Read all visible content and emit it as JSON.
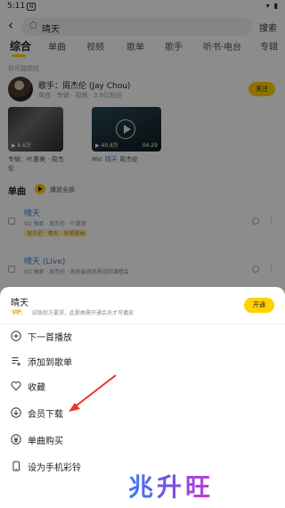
{
  "status": {
    "time": "5:11",
    "badge": "N"
  },
  "search": {
    "query": "晴天",
    "button": "搜索"
  },
  "tabs": [
    "综合",
    "单曲",
    "视频",
    "歌单",
    "歌手",
    "听书·电台",
    "专辑"
  ],
  "section_hint": "你可能想找",
  "artist": {
    "name": "歌手：周杰伦 (Jay Chou)",
    "sub": "单曲 · 专辑 · 视频 · 3.6亿粉丝",
    "follow": "关注"
  },
  "cards": [
    {
      "count": "▶ 6.6万",
      "caption": "专辑：叶惠美 · 周杰伦"
    },
    {
      "count": "▶ 40.8万",
      "duration": "04:29",
      "caption_prefix": "MV: ",
      "caption_hl": "晴天",
      "caption_suffix": " 周杰伦"
    }
  ],
  "singles": {
    "title": "单曲",
    "play_all": "播放全部"
  },
  "songs": [
    {
      "title": "晴天",
      "meta": "SQ 独家 · 周杰伦 · 叶惠美",
      "tag": "周杰伦 · 晴天 · 原唱歌曲"
    },
    {
      "title": "晴天 (Live)",
      "meta": "SQ 独家 · 周杰伦 · 地表最强世界巡回演唱会",
      "tag": ""
    }
  ],
  "sheet": {
    "title": "晴天",
    "tag": "VIP",
    "sub": "应版权方要求，此歌曲需开通会员才可播放",
    "vip_button": "开通",
    "menu": [
      {
        "icon": "play-next-icon",
        "label": "下一首播放"
      },
      {
        "icon": "add-to-playlist-icon",
        "label": "添加到歌单"
      },
      {
        "icon": "heart-icon",
        "label": "收藏"
      },
      {
        "icon": "download-icon",
        "label": "会员下载"
      },
      {
        "icon": "purchase-icon",
        "label": "单曲购买"
      },
      {
        "icon": "ringtone-icon",
        "label": "设为手机彩铃"
      }
    ]
  },
  "watermark": "兆升旺",
  "colors": {
    "accent": "#ffd200",
    "link": "#3a7bd5",
    "arrow": "#e8352c"
  }
}
